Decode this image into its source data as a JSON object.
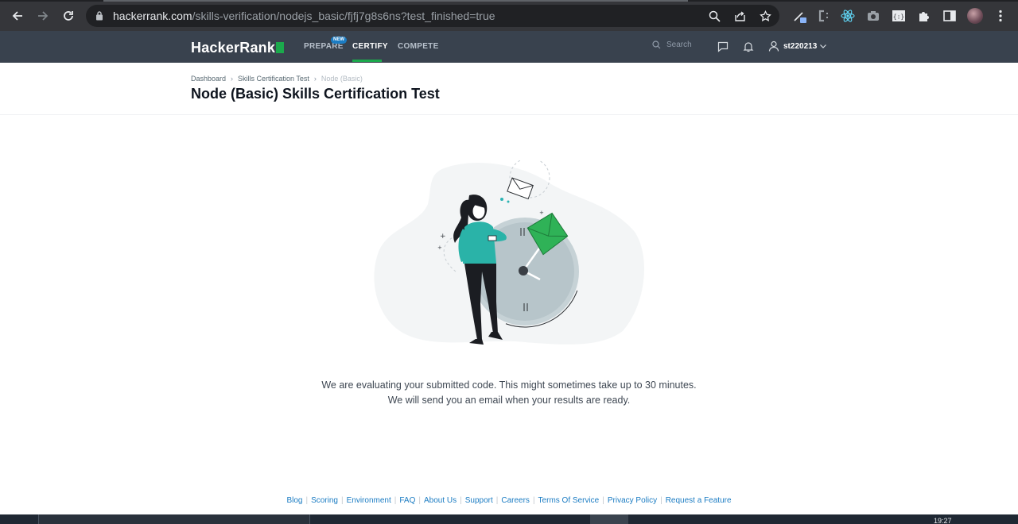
{
  "browser": {
    "url_host": "hackerrank.com",
    "url_path": "/skills-verification/nodejs_basic/fjfj7g8s6ns?test_finished=true",
    "icons": [
      "back-arrow-icon",
      "forward-arrow-icon",
      "reload-icon",
      "lock-icon",
      "zoom-icon",
      "share-icon",
      "star-icon",
      "extension-icon",
      "puzzle-icon",
      "sidebar-icon",
      "menu-icon"
    ]
  },
  "header": {
    "logo": "HackerRank",
    "nav": [
      {
        "label": "PREPARE",
        "badge": "NEW"
      },
      {
        "label": "CERTIFY",
        "active": true
      },
      {
        "label": "COMPETE"
      }
    ],
    "search_label": "Search",
    "username": "st220213"
  },
  "breadcrumb": {
    "items": [
      "Dashboard",
      "Skills Certification Test",
      "Node (Basic)"
    ]
  },
  "page": {
    "title": "Node (Basic) Skills Certification Test"
  },
  "main": {
    "message_line1": "We are evaluating your submitted code. This might sometimes take up to 30 minutes.",
    "message_line2": "We will send you an email when your results are ready."
  },
  "footer": {
    "links": [
      "Blog",
      "Scoring",
      "Environment",
      "FAQ",
      "About Us",
      "Support",
      "Careers",
      "Terms Of Service",
      "Privacy Policy",
      "Request a Feature"
    ]
  },
  "taskbar": {
    "time": "19:27"
  },
  "colors": {
    "header_bg": "#39424e",
    "accent_green": "#1ba94c",
    "link_blue": "#1b7cc3"
  }
}
